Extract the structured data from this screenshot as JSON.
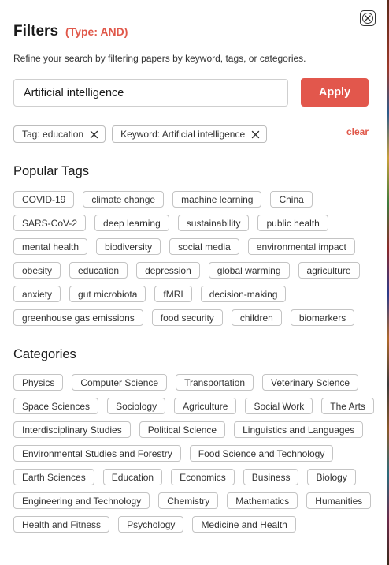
{
  "header": {
    "title": "Filters",
    "type_label": "(Type: AND)",
    "subtitle": "Refine your search by filtering papers by keyword, tags, or categories."
  },
  "search": {
    "value": "Artificial intelligence",
    "apply_label": "Apply"
  },
  "active_filters": {
    "items": [
      "Tag: education",
      "Keyword: Artificial intelligence"
    ],
    "clear_label": "clear"
  },
  "popular_tags": {
    "heading": "Popular Tags",
    "items": [
      "COVID-19",
      "climate change",
      "machine learning",
      "China",
      "SARS-CoV-2",
      "deep learning",
      "sustainability",
      "public health",
      "mental health",
      "biodiversity",
      "social media",
      "environmental impact",
      "obesity",
      "education",
      "depression",
      "global warming",
      "agriculture",
      "anxiety",
      "gut microbiota",
      "fMRI",
      "decision-making",
      "greenhouse gas emissions",
      "food security",
      "children",
      "biomarkers"
    ]
  },
  "categories": {
    "heading": "Categories",
    "items": [
      "Physics",
      "Computer Science",
      "Transportation",
      "Veterinary Science",
      "Space Sciences",
      "Sociology",
      "Agriculture",
      "Social Work",
      "The Arts",
      "Interdisciplinary Studies",
      "Political Science",
      "Linguistics and Languages",
      "Environmental Studies and Forestry",
      "Food Science and Technology",
      "Earth Sciences",
      "Education",
      "Economics",
      "Business",
      "Biology",
      "Engineering and Technology",
      "Chemistry",
      "Mathematics",
      "Humanities",
      "Health and Fitness",
      "Psychology",
      "Medicine and Health"
    ]
  }
}
